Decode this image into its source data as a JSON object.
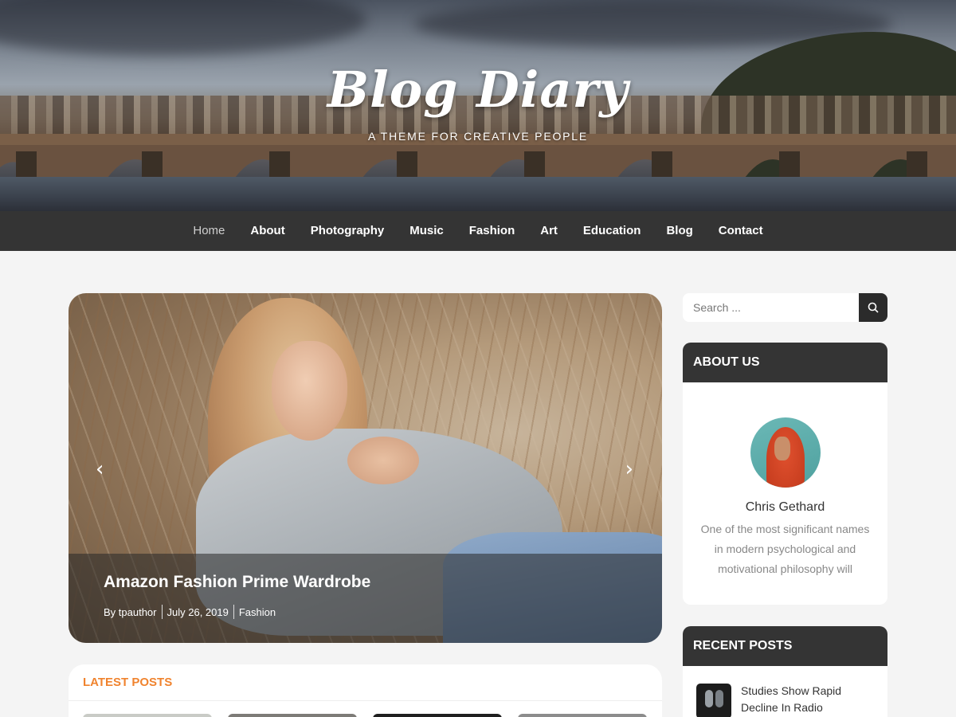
{
  "site": {
    "title": "Blog Diary",
    "tagline": "A THEME FOR CREATIVE PEOPLE"
  },
  "nav": {
    "items": [
      {
        "label": "Home",
        "active": true
      },
      {
        "label": "About"
      },
      {
        "label": "Photography"
      },
      {
        "label": "Music"
      },
      {
        "label": "Fashion"
      },
      {
        "label": "Art"
      },
      {
        "label": "Education"
      },
      {
        "label": "Blog"
      },
      {
        "label": "Contact"
      }
    ]
  },
  "slider": {
    "prev_icon": "‹",
    "next_icon": "›",
    "post_title": "Amazon Fashion Prime Wardrobe",
    "author": "By tpauthor",
    "date": "July 26, 2019",
    "category": "Fashion"
  },
  "latest": {
    "heading": "LATEST POSTS",
    "heading_color": "#f0832e"
  },
  "search": {
    "placeholder": "Search ..."
  },
  "about_widget": {
    "heading": "ABOUT US",
    "name": "Chris Gethard",
    "bio": "One of the most significant names in modern psychological and motivational philosophy will"
  },
  "recent_widget": {
    "heading": "RECENT POSTS",
    "posts": [
      {
        "title": "Studies Show Rapid Decline In Radio"
      }
    ]
  },
  "colors": {
    "nav_bg": "#343434",
    "accent": "#f0832e",
    "page_bg": "#f4f4f4"
  }
}
